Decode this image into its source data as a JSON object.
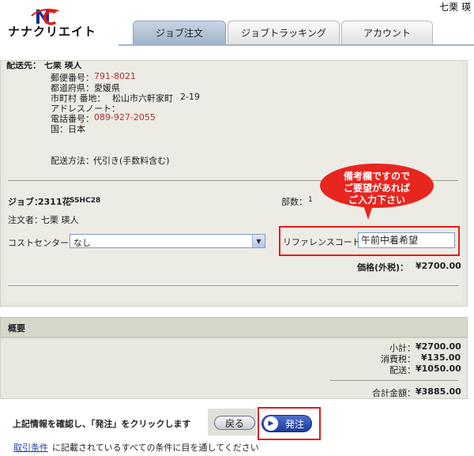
{
  "header": {
    "user_name": "七栗 瑛",
    "logo_text": "ナナクリエイト",
    "tabs": [
      {
        "label": "ジョブ注文",
        "active": true
      },
      {
        "label": "ジョブトラッキング",
        "active": false
      },
      {
        "label": "アカウント",
        "active": false
      }
    ]
  },
  "shipping": {
    "section_partial": "配送先： 七栗 瑛人",
    "postal_label": "郵便番号：",
    "postal": "791-8021",
    "pref_label": "都道府県：",
    "pref": "愛媛県",
    "city_label": "市町村 番地：",
    "city": "松山市六軒家町",
    "city_no": "2-19",
    "address_note_label": "アドレスノート：",
    "phone_label": "電話番号：",
    "phone": "089-927-2055",
    "country_label": "国：",
    "country": "日本",
    "method_label": "配送方法：",
    "method": "代引き(手数料含む)"
  },
  "job": {
    "job_label": "ジョブ：",
    "job_name": "2311花",
    "job_code": "SSHC28",
    "copies_label": "部数：",
    "copies": "1",
    "orderer_label": "注文者：",
    "orderer": "七栗 瑛人",
    "cost_center_label": "コストセンター：",
    "cost_center_value": "なし",
    "reference_label": "リファレンスコード：",
    "reference_value": "午前中着希望",
    "price_label": "価格(外税)：",
    "price": "¥2700.00"
  },
  "callout": {
    "line1": "備考欄ですので",
    "line2": "ご要望があれば",
    "line3": "ご入力下さい",
    "color": "#e8251f"
  },
  "summary": {
    "title": "概要",
    "subtotal_label": "小計：",
    "subtotal": "¥2700.00",
    "tax_label": "消費税：",
    "tax": "¥135.00",
    "shipping_label": "配送：",
    "shipping": "¥1050.00",
    "total_label": "合計金額：",
    "total": "¥3885.00"
  },
  "footer": {
    "confirm_text": "上記情報を確認し、「発注」をクリックします",
    "back_label": "戻る",
    "order_label": "発注",
    "terms_link": "取引条件",
    "terms_rest": "に記載されているすべての条件に目を通してください"
  },
  "colors": {
    "accent_red": "#e31b1b",
    "order_blue": "#1f3a9a",
    "tab_active": "#9fb4ca"
  }
}
